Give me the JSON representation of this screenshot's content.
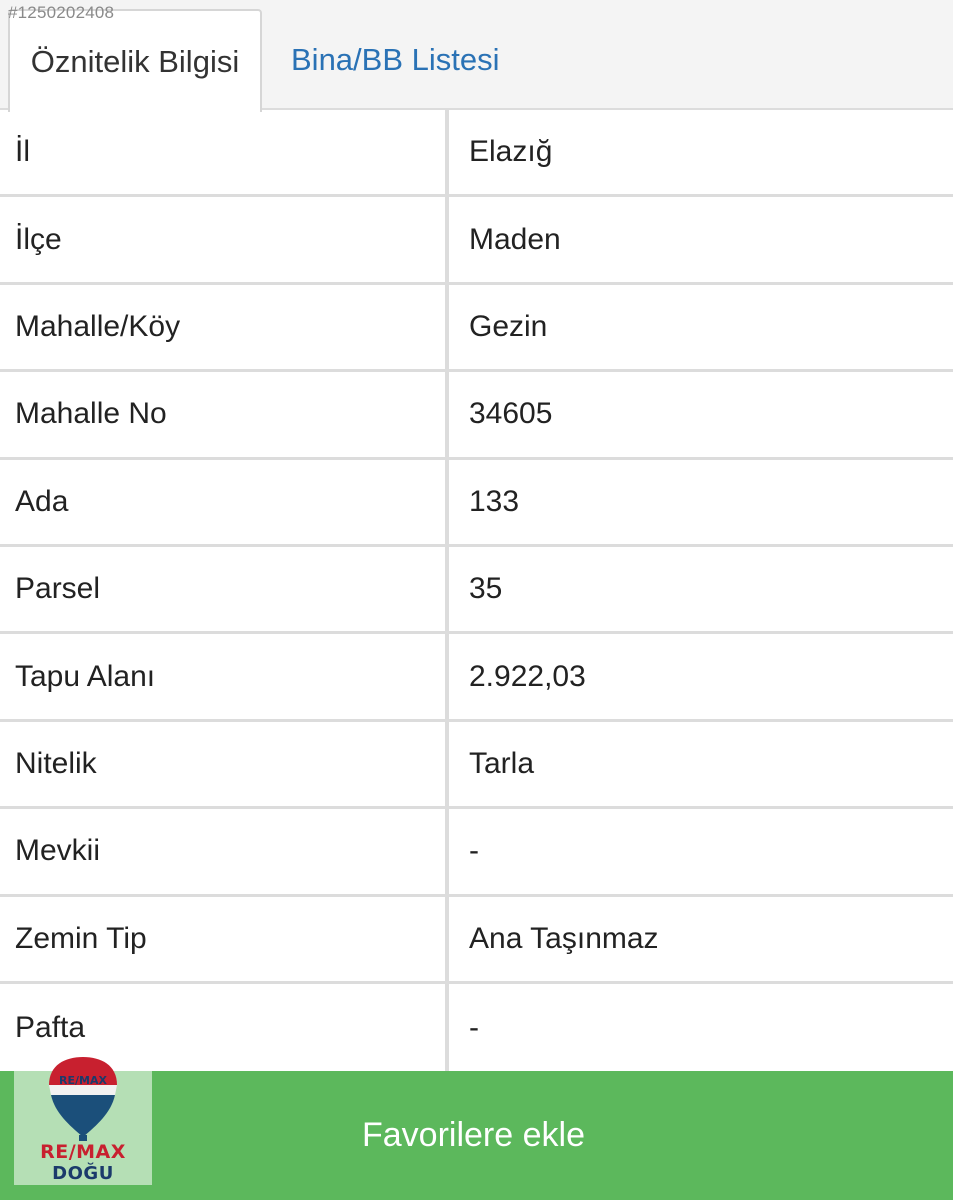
{
  "listing_id": "#1250202408",
  "tabs": [
    {
      "label": "Öznitelik Bilgisi",
      "active": true
    },
    {
      "label": "Bina/BB Listesi",
      "active": false
    }
  ],
  "rows": [
    {
      "key": "İl",
      "value": "Elazığ"
    },
    {
      "key": "İlçe",
      "value": "Maden"
    },
    {
      "key": "Mahalle/Köy",
      "value": "Gezin"
    },
    {
      "key": "Mahalle No",
      "value": "34605"
    },
    {
      "key": "Ada",
      "value": "133"
    },
    {
      "key": "Parsel",
      "value": "35"
    },
    {
      "key": "Tapu Alanı",
      "value": "2.922,03"
    },
    {
      "key": "Nitelik",
      "value": "Tarla"
    },
    {
      "key": "Mevkii",
      "value": "-"
    },
    {
      "key": "Zemin Tip",
      "value": "Ana Taşınmaz"
    },
    {
      "key": "Pafta",
      "value": "-"
    }
  ],
  "favorite_button": {
    "label": "Favorilere ekle"
  },
  "logo": {
    "balloon_text": "RE/MAX",
    "brand": "RE/MAX",
    "office": "DOĞU"
  },
  "colors": {
    "tab_link": "#2a72b5",
    "favorite_bg": "#5cb85c",
    "logo_red": "#c8202f",
    "logo_blue": "#1b3a6b"
  }
}
